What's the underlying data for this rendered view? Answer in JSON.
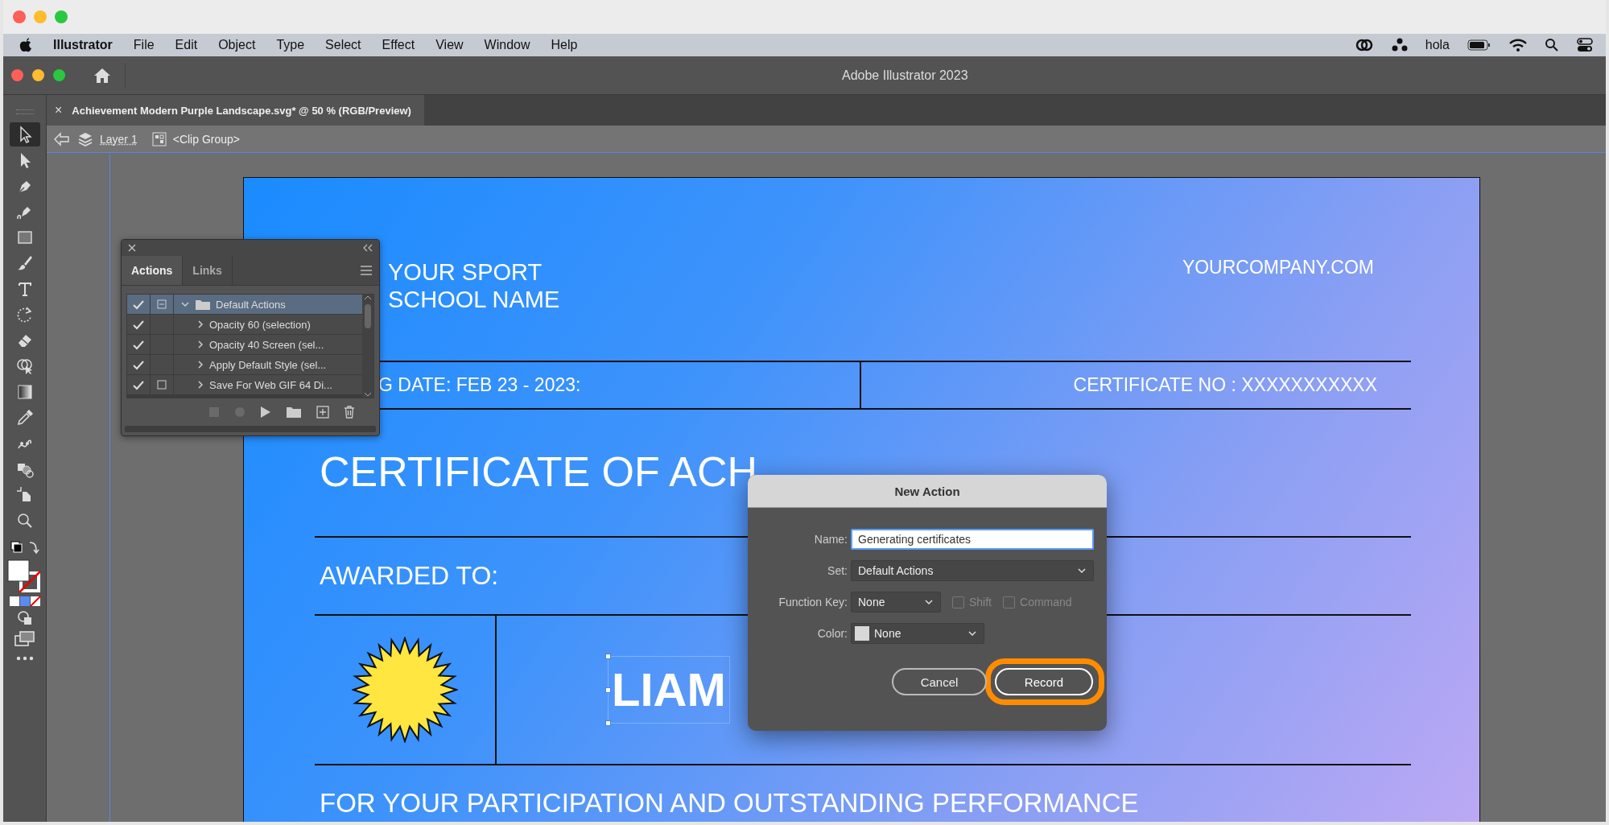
{
  "menu_bar": {
    "app_name": "Illustrator",
    "items": [
      "File",
      "Edit",
      "Object",
      "Type",
      "Select",
      "Effect",
      "View",
      "Window",
      "Help"
    ],
    "user": "hola"
  },
  "app_title": "Adobe Illustrator 2023",
  "tools": [
    {
      "kind": "selection",
      "selected": true
    },
    {
      "kind": "direct-selection",
      "selected": false
    },
    {
      "kind": "pen",
      "selected": false
    },
    {
      "kind": "curvature",
      "selected": false
    },
    {
      "kind": "rectangle",
      "selected": false
    },
    {
      "kind": "paintbrush",
      "selected": false
    },
    {
      "kind": "type",
      "selected": false
    },
    {
      "kind": "rotate",
      "selected": false
    },
    {
      "kind": "eraser",
      "selected": false
    },
    {
      "kind": "shape-builder",
      "selected": false
    },
    {
      "kind": "gradient",
      "selected": false
    },
    {
      "kind": "eyedropper",
      "selected": false
    },
    {
      "kind": "puppet-warp",
      "selected": false
    },
    {
      "kind": "shapes",
      "selected": false
    },
    {
      "kind": "artboard",
      "selected": false
    },
    {
      "kind": "zoom",
      "selected": false
    }
  ],
  "document_tab": {
    "close": "×",
    "title": "Achievement Modern Purple Landscape.svg* @ 50 % (RGB/Preview)"
  },
  "breadcrumb": {
    "layer": "Layer 1",
    "group": "<Clip Group>"
  },
  "certificate": {
    "school_name": [
      "YOUR SPORT",
      "SCHOOL NAME"
    ],
    "website": "YOURCOMPANY.COM",
    "date": "G DATE: FEB 23 - 2023:",
    "certificate_no": "CERTIFICATE NO : XXXXXXXXXXX",
    "title": "CERTIFICATE OF ACH",
    "awarded_label": "AWARDED TO:",
    "recipient": "LIAM",
    "footer": "FOR YOUR PARTICIPATION AND OUTSTANDING PERFORMANCE"
  },
  "actions_panel": {
    "tabs": [
      {
        "label": "Actions",
        "selected": true
      },
      {
        "label": "Links",
        "selected": false
      }
    ],
    "sets": [
      {
        "name": "Default Actions",
        "checked": true,
        "dialog": true,
        "dialog_partial": true,
        "expanded": true,
        "selected": true,
        "children": [
          {
            "name": "Opacity 60 (selection)",
            "checked": true,
            "dialog": false,
            "expanded": false,
            "selected": false
          },
          {
            "name": "Opacity 40 Screen (sel...",
            "checked": true,
            "dialog": false,
            "expanded": false,
            "selected": false
          },
          {
            "name": "Apply Default Style (sel...",
            "checked": true,
            "dialog": false,
            "expanded": false,
            "selected": false
          },
          {
            "name": "Save For Web GIF 64 Di...",
            "checked": true,
            "dialog": true,
            "dialog_partial": false,
            "expanded": false,
            "selected": false
          }
        ]
      }
    ]
  },
  "new_action_dialog": {
    "title": "New Action",
    "fields": [
      {
        "kind": "text",
        "label": "Name:",
        "value": "Generating certificates"
      },
      {
        "kind": "select",
        "label": "Set:",
        "value": "Default Actions"
      },
      {
        "kind": "key",
        "label": "Function Key:",
        "value": "None",
        "options": [
          {
            "label": "Shift",
            "checked": false,
            "disabled": true
          },
          {
            "label": "Command",
            "checked": false,
            "disabled": true
          }
        ]
      },
      {
        "kind": "color",
        "label": "Color:",
        "value": "None"
      }
    ],
    "buttons": [
      {
        "label": "Cancel",
        "default": false,
        "highlighted": false
      },
      {
        "label": "Record",
        "default": true,
        "highlighted": true
      }
    ]
  }
}
